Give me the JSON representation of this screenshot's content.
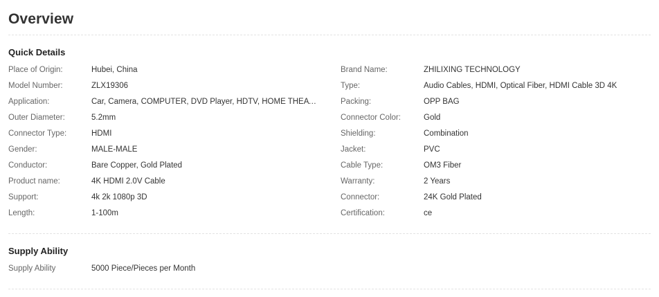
{
  "overview": {
    "title": "Overview"
  },
  "quick_details": {
    "title": "Quick Details",
    "rows": [
      {
        "left_label": "Place of Origin:",
        "left_value": "Hubei, China",
        "right_label": "Brand Name:",
        "right_value": "ZHILIXING TECHNOLOGY"
      },
      {
        "left_label": "Model Number:",
        "left_value": "ZLX19306",
        "right_label": "Type:",
        "right_value": "Audio Cables, HDMI, Optical Fiber, HDMI Cable 3D 4K"
      },
      {
        "left_label": "Application:",
        "left_value": "Car, Camera, COMPUTER, DVD Player, HDTV, HOME THEATE...",
        "right_label": "Packing:",
        "right_value": "OPP BAG"
      },
      {
        "left_label": "Outer Diameter:",
        "left_value": "5.2mm",
        "right_label": "Connector Color:",
        "right_value": "Gold"
      },
      {
        "left_label": "Connector Type:",
        "left_value": "HDMI",
        "right_label": "Shielding:",
        "right_value": "Combination"
      },
      {
        "left_label": "Gender:",
        "left_value": "MALE-MALE",
        "right_label": "Jacket:",
        "right_value": "PVC"
      },
      {
        "left_label": "Conductor:",
        "left_value": "Bare Copper, Gold Plated",
        "right_label": "Cable Type:",
        "right_value": "OM3 Fiber"
      },
      {
        "left_label": "Product name:",
        "left_value": "4K HDMI 2.0V Cable",
        "right_label": "Warranty:",
        "right_value": "2 Years"
      },
      {
        "left_label": "Support:",
        "left_value": "4k 2k 1080p 3D",
        "right_label": "Connector:",
        "right_value": "24K Gold Plated"
      },
      {
        "left_label": "Length:",
        "left_value": "1-100m",
        "right_label": "Certification:",
        "right_value": "ce"
      }
    ]
  },
  "supply_ability": {
    "title": "Supply Ability",
    "label": "Supply Ability",
    "value": "5000 Piece/Pieces per Month"
  }
}
